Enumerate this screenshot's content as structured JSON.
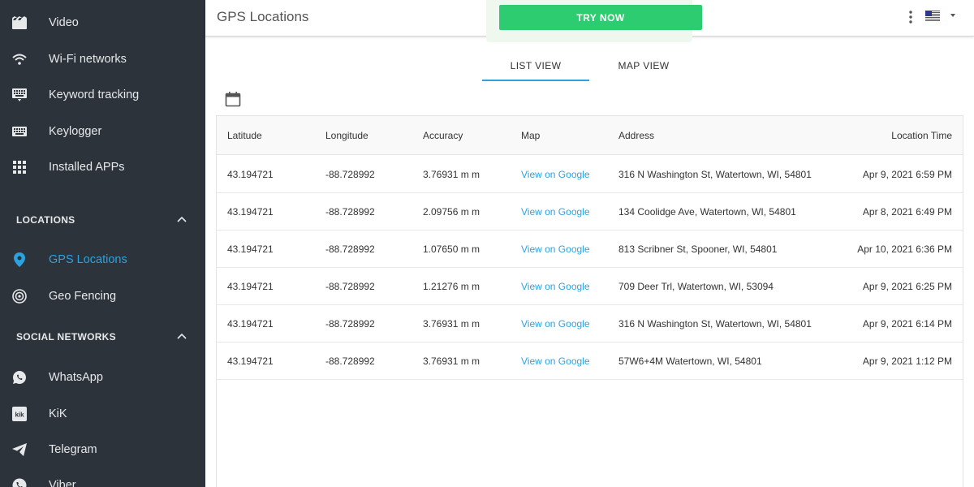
{
  "sidebar": {
    "items_top": [
      {
        "label": "Video",
        "icon": "video-icon"
      },
      {
        "label": "Wi-Fi networks",
        "icon": "wifi-icon"
      },
      {
        "label": "Keyword tracking",
        "icon": "keyboard-icon"
      },
      {
        "label": "Keylogger",
        "icon": "keyboard-icon"
      },
      {
        "label": "Installed APPs",
        "icon": "apps-grid-icon"
      }
    ],
    "locations_header": "LOCATIONS",
    "locations_items": [
      {
        "label": "GPS Locations",
        "icon": "location-pin-icon",
        "active": true
      },
      {
        "label": "Geo Fencing",
        "icon": "target-icon",
        "active": false
      }
    ],
    "social_header": "SOCIAL NETWORKS",
    "social_items": [
      {
        "label": "WhatsApp",
        "icon": "whatsapp-icon"
      },
      {
        "label": "KiK",
        "icon": "kik-icon"
      },
      {
        "label": "Telegram",
        "icon": "telegram-icon"
      },
      {
        "label": "Viber",
        "icon": "viber-icon"
      }
    ]
  },
  "header": {
    "title": "GPS Locations",
    "try_now": "TRY NOW",
    "language_flag": "us-flag-icon"
  },
  "tabs": {
    "list_view": "LIST VIEW",
    "map_view": "MAP VIEW",
    "active": "list_view"
  },
  "table": {
    "columns": [
      "Latitude",
      "Longitude",
      "Accuracy",
      "Map",
      "Address",
      "Location Time"
    ],
    "rows": [
      {
        "lat": "43.194721",
        "lng": "-88.728992",
        "acc": "3.76931 m m",
        "map": "View on Google",
        "address": "316 N Washington St, Watertown, WI, 54801",
        "time": "Apr 9, 2021 6:59 PM"
      },
      {
        "lat": "43.194721",
        "lng": "-88.728992",
        "acc": "2.09756 m m",
        "map": "View on Google",
        "address": "134 Coolidge Ave, Watertown, WI, 54801",
        "time": "Apr 8, 2021 6:49 PM"
      },
      {
        "lat": "43.194721",
        "lng": "-88.728992",
        "acc": "1.07650 m m",
        "map": "View on Google",
        "address": "813 Scribner St, Spooner, WI, 54801",
        "time": "Apr 10, 2021 6:36 PM"
      },
      {
        "lat": "43.194721",
        "lng": "-88.728992",
        "acc": "1.21276 m m",
        "map": "View on Google",
        "address": "709 Deer Trl, Watertown, WI, 53094",
        "time": "Apr 9, 2021 6:25 PM"
      },
      {
        "lat": "43.194721",
        "lng": "-88.728992",
        "acc": "3.76931 m m",
        "map": "View on Google",
        "address": "316 N Washington St, Watertown, WI, 54801",
        "time": "Apr 9, 2021 6:14 PM"
      },
      {
        "lat": "43.194721",
        "lng": "-88.728992",
        "acc": "3.76931 m m",
        "map": "View on Google",
        "address": "57W6+4M Watertown, WI, 54801",
        "time": "Apr 9, 2021 1:12 PM"
      }
    ]
  },
  "colors": {
    "sidebar_bg": "#2c333b",
    "accent": "#2aa3e0",
    "try_now_bg": "#2ecc71"
  }
}
